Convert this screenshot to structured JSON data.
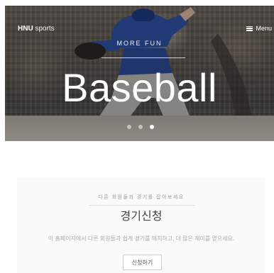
{
  "nav": {
    "brand_strong": "HNU",
    "brand_light": "sports",
    "menu_label": "Menu"
  },
  "hero": {
    "kicker": "MORE FUN",
    "title": "Baseball",
    "slides": 3,
    "active_slide": 3
  },
  "card": {
    "kicker": "다른 회원들과 경기를 잡아보세요",
    "title": "경기신청",
    "description": "이 홈페이지에서 다른 회원들과 쉽게 경기를 매치하고, 더 많은 재미를 얻으세요.",
    "button_label": "신청하기"
  },
  "colors": {
    "hero_overlay": "#5a5650",
    "jersey_blue": "#2e4fa1",
    "card_bg": "#fafafa"
  },
  "icons": {
    "menu": "hamburger-icon",
    "slider_dots": "dot-indicator"
  }
}
